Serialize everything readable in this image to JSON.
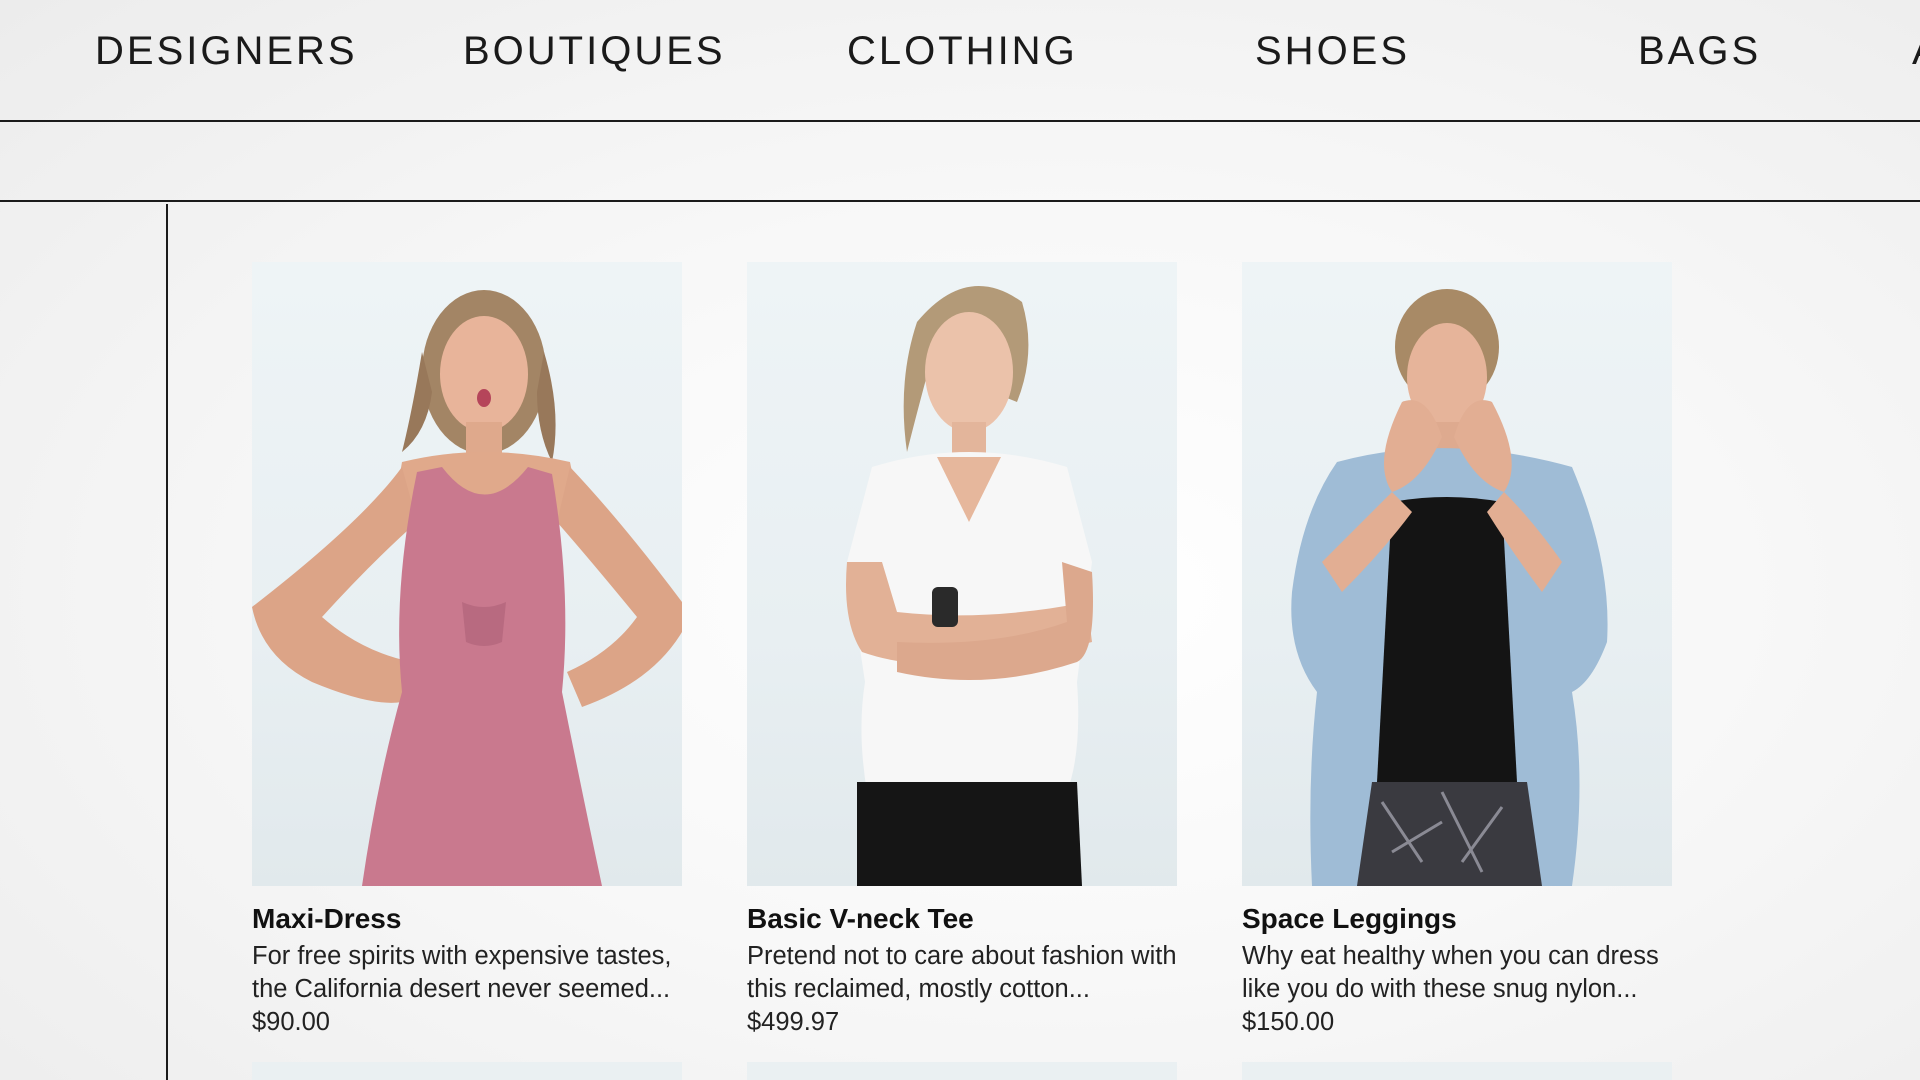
{
  "nav": {
    "items": [
      {
        "label": "DESIGNERS"
      },
      {
        "label": "BOUTIQUES"
      },
      {
        "label": "CLOTHING"
      },
      {
        "label": "SHOES"
      },
      {
        "label": "BAGS"
      },
      {
        "label": "A"
      }
    ]
  },
  "products": [
    {
      "title": "Maxi-Dress",
      "description": "For free spirits with expensive tastes, the California desert never seemed...",
      "price": "$90.00"
    },
    {
      "title": "Basic V-neck Tee",
      "description": "Pretend not to care about fashion with this reclaimed, mostly cotton...",
      "price": "$499.97"
    },
    {
      "title": "Space Leggings",
      "description": "Why eat healthy when you can dress like you do with these snug nylon...",
      "price": "$150.00"
    }
  ],
  "colors": {
    "dress": "#c9798e",
    "tee": "#f7f7f7",
    "jacket": "#9fbcd6",
    "top": "#141414",
    "line": "#1b1b1b"
  }
}
